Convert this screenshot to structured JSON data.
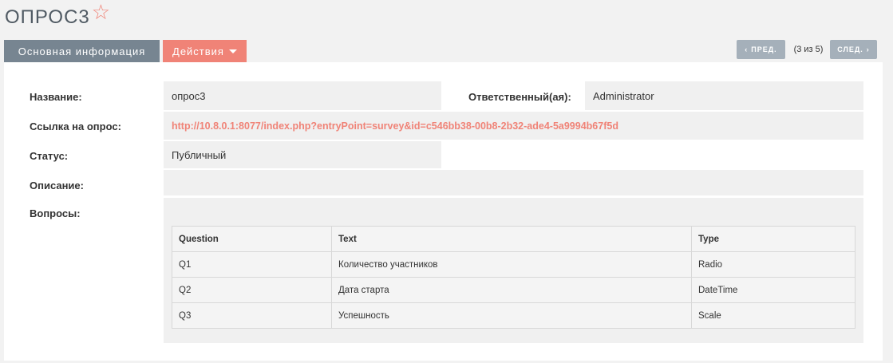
{
  "header": {
    "title": "ОПРОС3"
  },
  "tabs": {
    "main": "Основная информация",
    "actions": "Действия"
  },
  "nav": {
    "prev": "ПРЕД.",
    "count": "(3 из 5)",
    "next": "СЛЕД."
  },
  "fields": {
    "name_label": "Название:",
    "name_value": "опрос3",
    "owner_label": "Ответственный(ая):",
    "owner_value": "Administrator",
    "link_label": "Ссылка на опрос:",
    "link_value": "http://10.8.0.1:8077/index.php?entryPoint=survey&id=c546bb38-00b8-2b32-ade4-5a9994b67f5d",
    "status_label": "Статус:",
    "status_value": "Публичный",
    "description_label": "Описание:",
    "description_value": "",
    "questions_label": "Вопросы:"
  },
  "questions": {
    "headers": [
      "Question",
      "Text",
      "Type"
    ],
    "rows": [
      [
        "Q1",
        "Количество участников",
        "Radio"
      ],
      [
        "Q2",
        "Дата старта",
        "DateTime"
      ],
      [
        "Q3",
        "Успешность",
        "Scale"
      ]
    ]
  },
  "colors": {
    "accent": "#f08377",
    "tab": "#778591",
    "nav": "#a5b0ba"
  }
}
